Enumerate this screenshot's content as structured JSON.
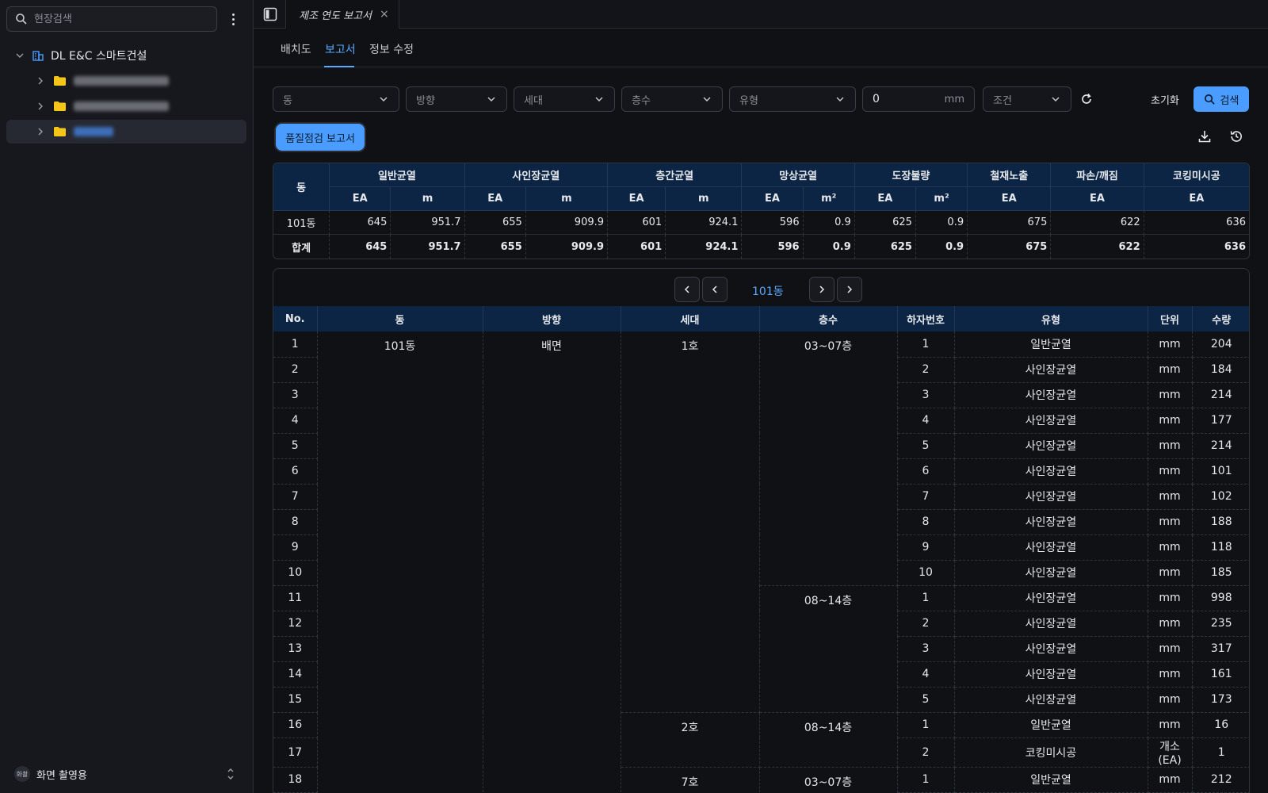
{
  "sidebar": {
    "search_placeholder": "현장검색",
    "root_label": "DL E&C 스마트건설",
    "items": [
      {
        "blur_color": "#6a6d74",
        "blur_width": 120
      },
      {
        "blur_color": "#6a6d74",
        "blur_width": 120
      },
      {
        "blur_color": "#3d6fb8",
        "blur_width": 50
      }
    ],
    "footer_badge": "화촬",
    "footer_label": "화면 촬영용"
  },
  "tabbar": {
    "doc_tab_title": "제조 연도 보고서",
    "close": "×"
  },
  "subtabs": [
    "배치도",
    "보고서",
    "정보 수정"
  ],
  "filters": {
    "dong": "동",
    "direction": "방향",
    "unit": "세대",
    "floor": "층수",
    "type": "유형",
    "mm_value": "0",
    "mm_unit": "mm",
    "condition": "조건",
    "reset": "초기화",
    "search": "검색"
  },
  "report_button": "품질점검 보고서",
  "summary": {
    "groups": [
      "일반균열",
      "사인장균열",
      "층간균열",
      "망상균열",
      "도장불량",
      "철재노출",
      "파손/깨짐",
      "코킹미시공"
    ],
    "first_header": "동",
    "sub": [
      "EA",
      "m",
      "EA",
      "m",
      "EA",
      "m",
      "EA",
      "m²",
      "EA",
      "m²",
      "EA",
      "EA",
      "EA"
    ],
    "rows": [
      {
        "label": "101동",
        "values": [
          "645",
          "951.7",
          "655",
          "909.9",
          "601",
          "924.1",
          "596",
          "0.9",
          "625",
          "0.9",
          "675",
          "622",
          "636"
        ]
      },
      {
        "label": "합계",
        "values": [
          "645",
          "951.7",
          "655",
          "909.9",
          "601",
          "924.1",
          "596",
          "0.9",
          "625",
          "0.9",
          "675",
          "622",
          "636"
        ]
      }
    ]
  },
  "pager": {
    "label": "101동"
  },
  "detail": {
    "headers": [
      "No.",
      "동",
      "방향",
      "세대",
      "층수",
      "하자번호",
      "유형",
      "단위",
      "수량"
    ],
    "dong": "101동",
    "direction": "배면",
    "units": [
      {
        "name": "1호",
        "rows": 15
      },
      {
        "name": "2호",
        "rows": 2
      },
      {
        "name": "7호",
        "rows": 1
      }
    ],
    "floors": [
      {
        "name": "03~07층",
        "rows": 10
      },
      {
        "name": "08~14층",
        "rows": 5
      },
      {
        "name": "08~14층",
        "rows": 2
      },
      {
        "name": "03~07층",
        "rows": 1
      }
    ],
    "rows": [
      {
        "no": "1",
        "defect": "1",
        "type": "일반균열",
        "unit": "mm",
        "qty": "204"
      },
      {
        "no": "2",
        "defect": "2",
        "type": "사인장균열",
        "unit": "mm",
        "qty": "184"
      },
      {
        "no": "3",
        "defect": "3",
        "type": "사인장균열",
        "unit": "mm",
        "qty": "214"
      },
      {
        "no": "4",
        "defect": "4",
        "type": "사인장균열",
        "unit": "mm",
        "qty": "177"
      },
      {
        "no": "5",
        "defect": "5",
        "type": "사인장균열",
        "unit": "mm",
        "qty": "214"
      },
      {
        "no": "6",
        "defect": "6",
        "type": "사인장균열",
        "unit": "mm",
        "qty": "101"
      },
      {
        "no": "7",
        "defect": "7",
        "type": "사인장균열",
        "unit": "mm",
        "qty": "102"
      },
      {
        "no": "8",
        "defect": "8",
        "type": "사인장균열",
        "unit": "mm",
        "qty": "188"
      },
      {
        "no": "9",
        "defect": "9",
        "type": "사인장균열",
        "unit": "mm",
        "qty": "118"
      },
      {
        "no": "10",
        "defect": "10",
        "type": "사인장균열",
        "unit": "mm",
        "qty": "185"
      },
      {
        "no": "11",
        "defect": "1",
        "type": "사인장균열",
        "unit": "mm",
        "qty": "998"
      },
      {
        "no": "12",
        "defect": "2",
        "type": "사인장균열",
        "unit": "mm",
        "qty": "235"
      },
      {
        "no": "13",
        "defect": "3",
        "type": "사인장균열",
        "unit": "mm",
        "qty": "317"
      },
      {
        "no": "14",
        "defect": "4",
        "type": "사인장균열",
        "unit": "mm",
        "qty": "161"
      },
      {
        "no": "15",
        "defect": "5",
        "type": "사인장균열",
        "unit": "mm",
        "qty": "173"
      },
      {
        "no": "16",
        "defect": "1",
        "type": "일반균열",
        "unit": "mm",
        "qty": "16"
      },
      {
        "no": "17",
        "defect": "2",
        "type": "코킹미시공",
        "unit": "개소(EA)",
        "qty": "1"
      },
      {
        "no": "18",
        "defect": "1",
        "type": "일반균열",
        "unit": "mm",
        "qty": "212"
      }
    ]
  },
  "colors": {
    "accent": "#4a9dff",
    "header_bg": "#0c2544",
    "folder": "#f5c518",
    "root_icon": "#4a9dff"
  }
}
